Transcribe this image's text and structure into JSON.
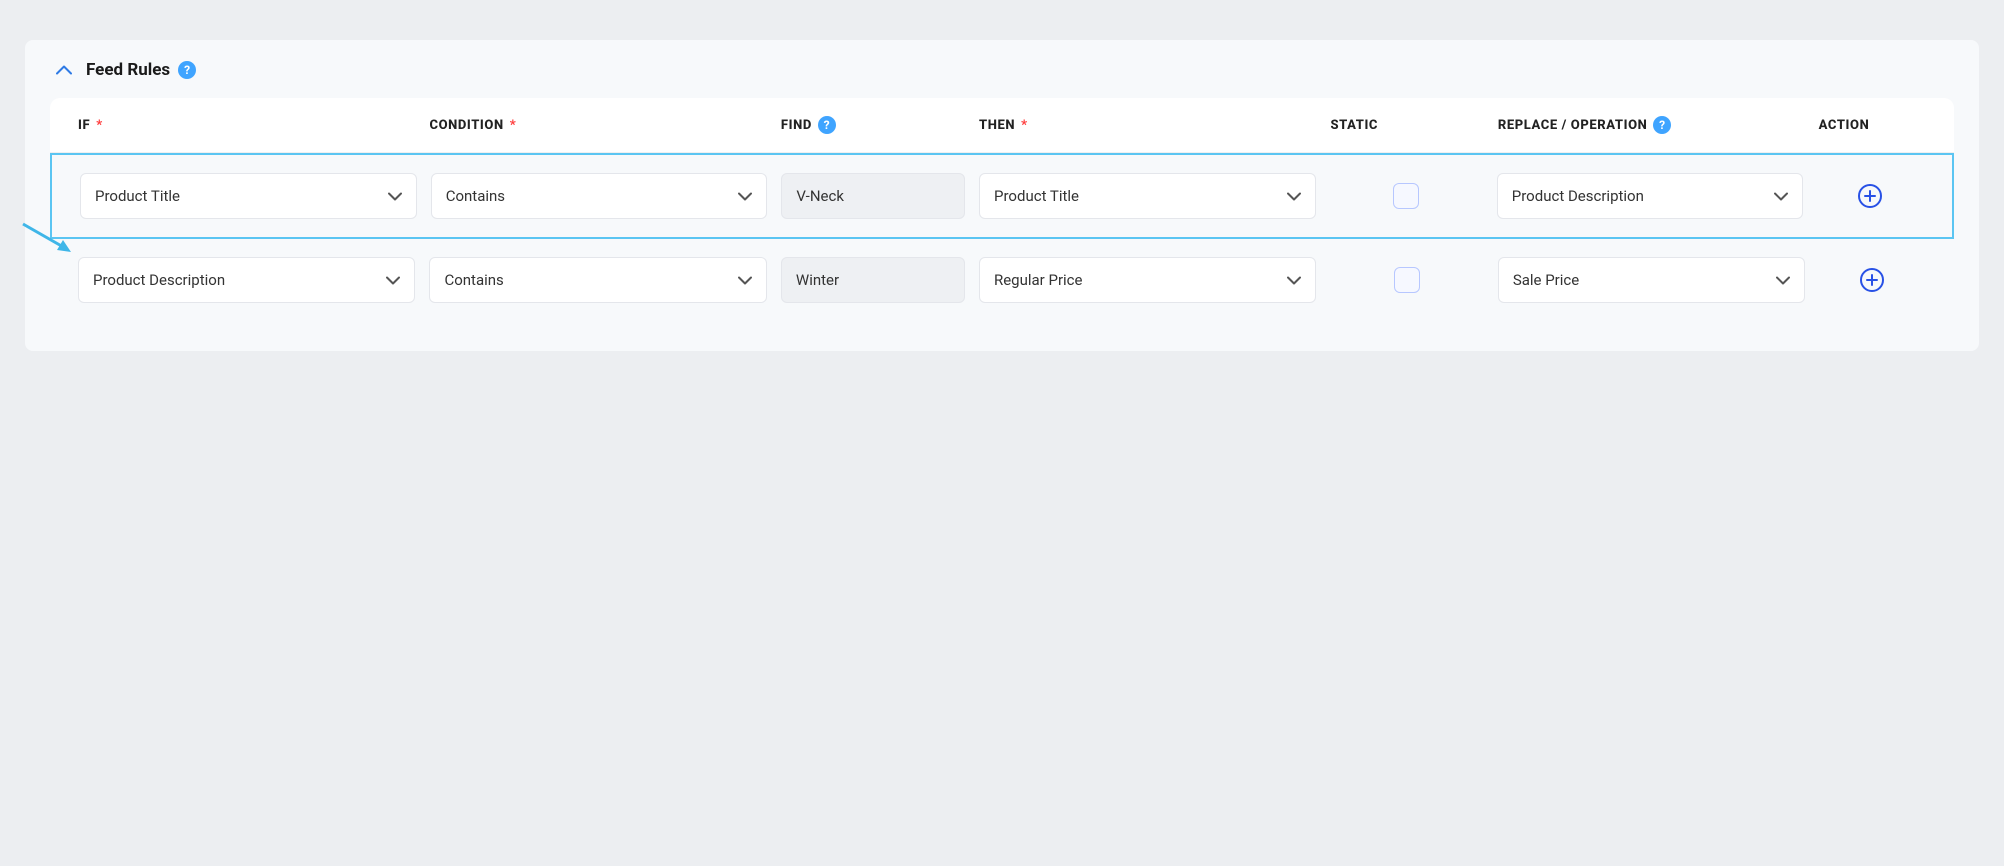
{
  "panel": {
    "title": "Feed Rules"
  },
  "columns": {
    "if": "IF",
    "condition": "CONDITION",
    "find": "FIND",
    "then": "THEN",
    "static": "STATIC",
    "replace": "REPLACE / OPERATION",
    "action": "ACTION"
  },
  "rows": [
    {
      "if": "Product Title",
      "condition": "Contains",
      "find": "V-Neck",
      "then": "Product Title",
      "static_checked": false,
      "replace": "Product Description",
      "highlighted": true
    },
    {
      "if": "Product Description",
      "condition": "Contains",
      "find": "Winter",
      "then": "Regular Price",
      "static_checked": false,
      "replace": "Sale Price",
      "highlighted": false
    }
  ]
}
